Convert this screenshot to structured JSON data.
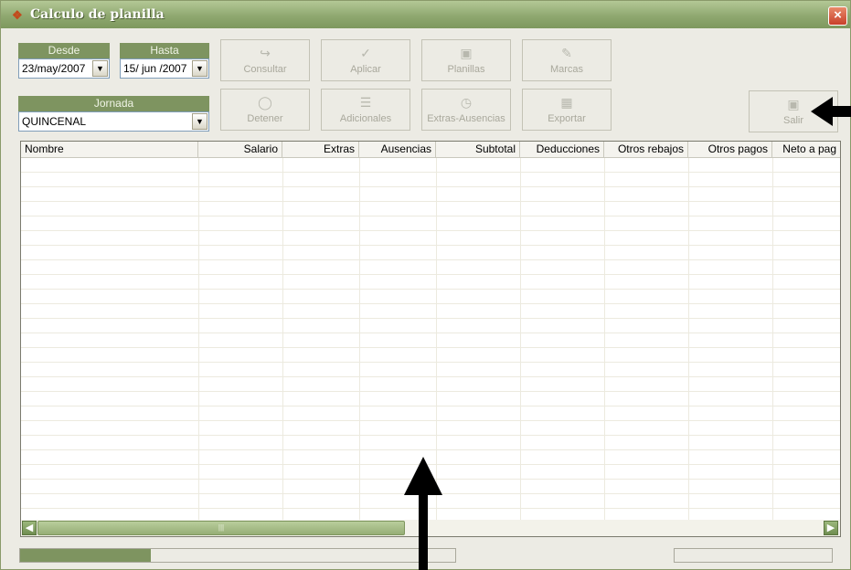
{
  "window": {
    "title": "Calculo de planilla",
    "close_label": "×"
  },
  "filters": {
    "desde_label": "Desde",
    "desde_value": "23/may/2007",
    "hasta_label": "Hasta",
    "hasta_value": "15/ jun /2007",
    "jornada_label": "Jornada",
    "jornada_value": "QUINCENAL"
  },
  "toolbar": {
    "consultar": "Consultar",
    "aplicar": "Aplicar",
    "planillas": "Planillas",
    "marcas": "Marcas",
    "detener": "Detener",
    "adicionales": "Adicionales",
    "extras_ausencias": "Extras-Ausencias",
    "exportar": "Exportar",
    "salir": "Salir"
  },
  "grid": {
    "columns": [
      "Nombre",
      "Salario",
      "Extras",
      "Ausencias",
      "Subtotal",
      "Deducciones",
      "Otros rebajos",
      "Otros pagos",
      "Neto a pag"
    ],
    "rows": []
  },
  "status": {
    "progress_fraction": 0.3
  },
  "colors": {
    "accent": "#7e9460",
    "titlebar": "#8fa870",
    "annotation_arrow": "#000000"
  }
}
